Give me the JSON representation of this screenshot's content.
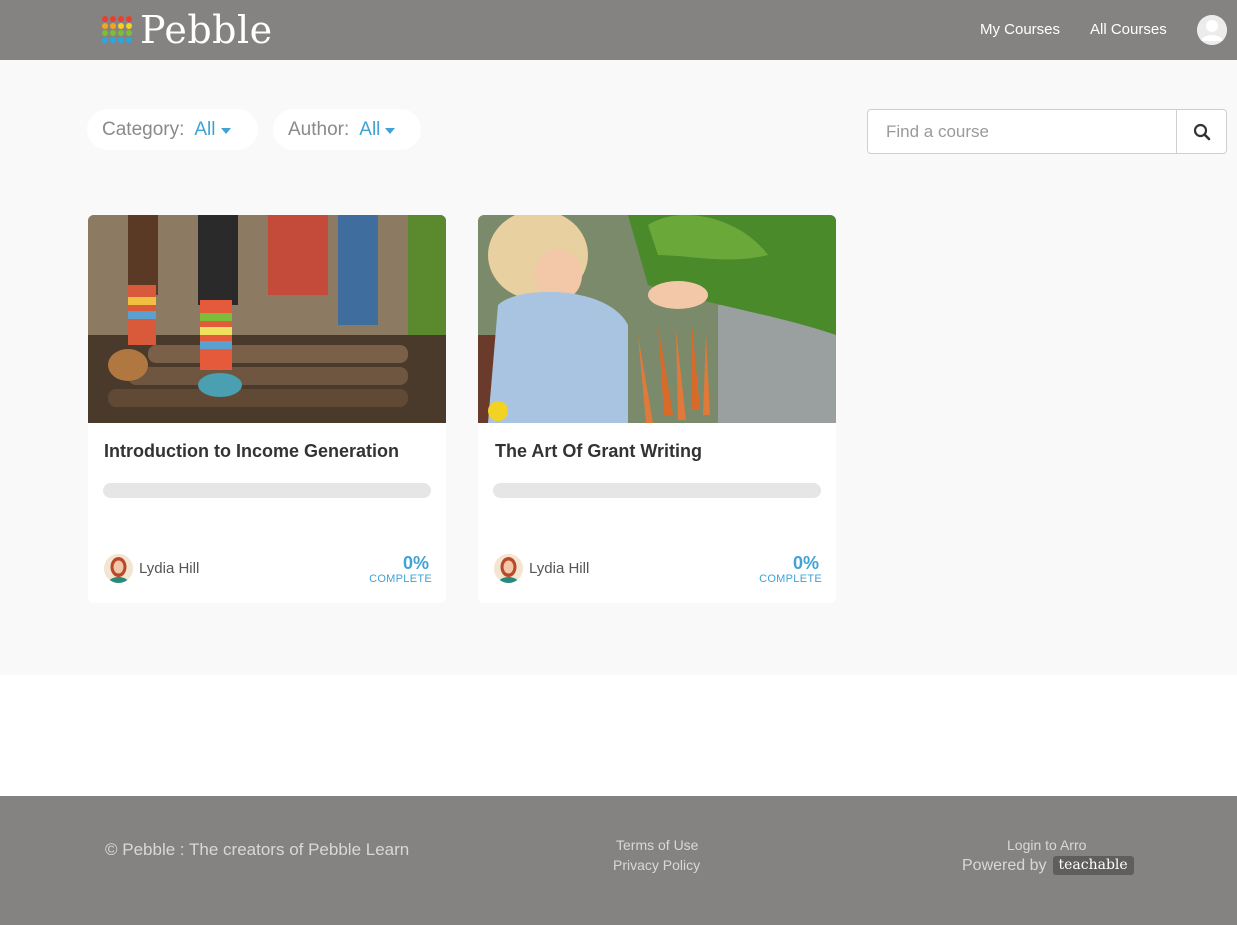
{
  "header": {
    "logo_text": "Pebble",
    "nav": {
      "my_courses": "My Courses",
      "all_courses": "All Courses"
    },
    "logo_colors": [
      "#e8402e",
      "#f4a422",
      "#f2d223",
      "#7cbd3a",
      "#2aa7df"
    ]
  },
  "filters": {
    "category_label": "Category:",
    "category_value": "All",
    "author_label": "Author:",
    "author_value": "All"
  },
  "search": {
    "placeholder": "Find a course"
  },
  "courses": [
    {
      "title": "Introduction to Income Generation",
      "author": "Lydia Hill",
      "progress_value": "0%",
      "progress_label": "COMPLETE",
      "progress": 0
    },
    {
      "title": "The Art Of Grant Writing",
      "author": "Lydia Hill",
      "progress_value": "0%",
      "progress_label": "COMPLETE",
      "progress": 0
    }
  ],
  "footer": {
    "copyright": "© Pebble : The creators of Pebble Learn",
    "terms": "Terms of Use",
    "privacy": "Privacy Policy",
    "login": "Login to Arro",
    "powered_by": "Powered by",
    "powered_brand": "teachable"
  },
  "colors": {
    "header_bg": "#858381",
    "accent": "#3fa3d6",
    "page_bg": "#f9f9f9"
  }
}
